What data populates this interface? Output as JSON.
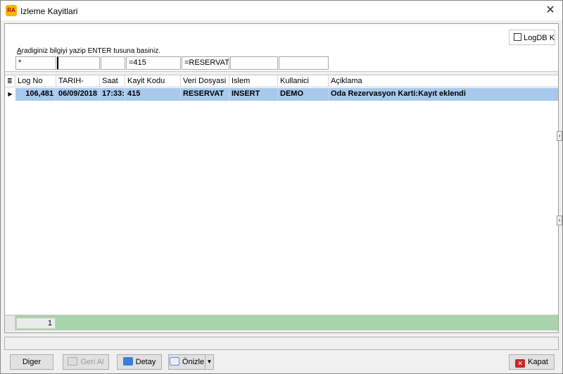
{
  "window": {
    "app_icon": "RA",
    "title": "Izleme Kayitlari",
    "close_glyph": "✕"
  },
  "filter_panel": {
    "logdb_label": "LogDB Ki",
    "logdb_checked": false,
    "hint_first_letter": "A",
    "hint_rest": "radiginiz bilgiyi yazip ENTER tusuna basiniz.",
    "filters": [
      "*",
      "",
      "",
      "=415",
      "=RESERVAT",
      "",
      "",
      ""
    ]
  },
  "grid": {
    "menu_icon": "≣",
    "columns": [
      "Log No",
      "TARIH-",
      "Saat",
      "Kayit Kodu",
      "Veri Dosyasi",
      "Islem",
      "Kullanici",
      "Açiklama"
    ],
    "rows": [
      {
        "indicator": "▶",
        "cells": [
          "106,481",
          "06/09/2018",
          "17:33:",
          "415",
          "RESERVAT",
          "INSERT",
          "DEMO",
          "Oda Rezervasyon Karti:Kayıt eklendi"
        ]
      }
    ],
    "footer_count": "1"
  },
  "buttons": {
    "diger": "Diger",
    "geri_al": "Geri Al",
    "detay": "Detay",
    "onizle": "Önizle",
    "kapat": "Kapat"
  },
  "icons": {
    "geri_al": "undo-icon",
    "detay": "folder-open-icon",
    "onizle": "preview-icon",
    "kapat": "close-circle-icon"
  },
  "colors": {
    "selected_row": "#a8c8ec",
    "footer_bar": "#a9d3a9",
    "kapat_icon": "#c62828"
  }
}
